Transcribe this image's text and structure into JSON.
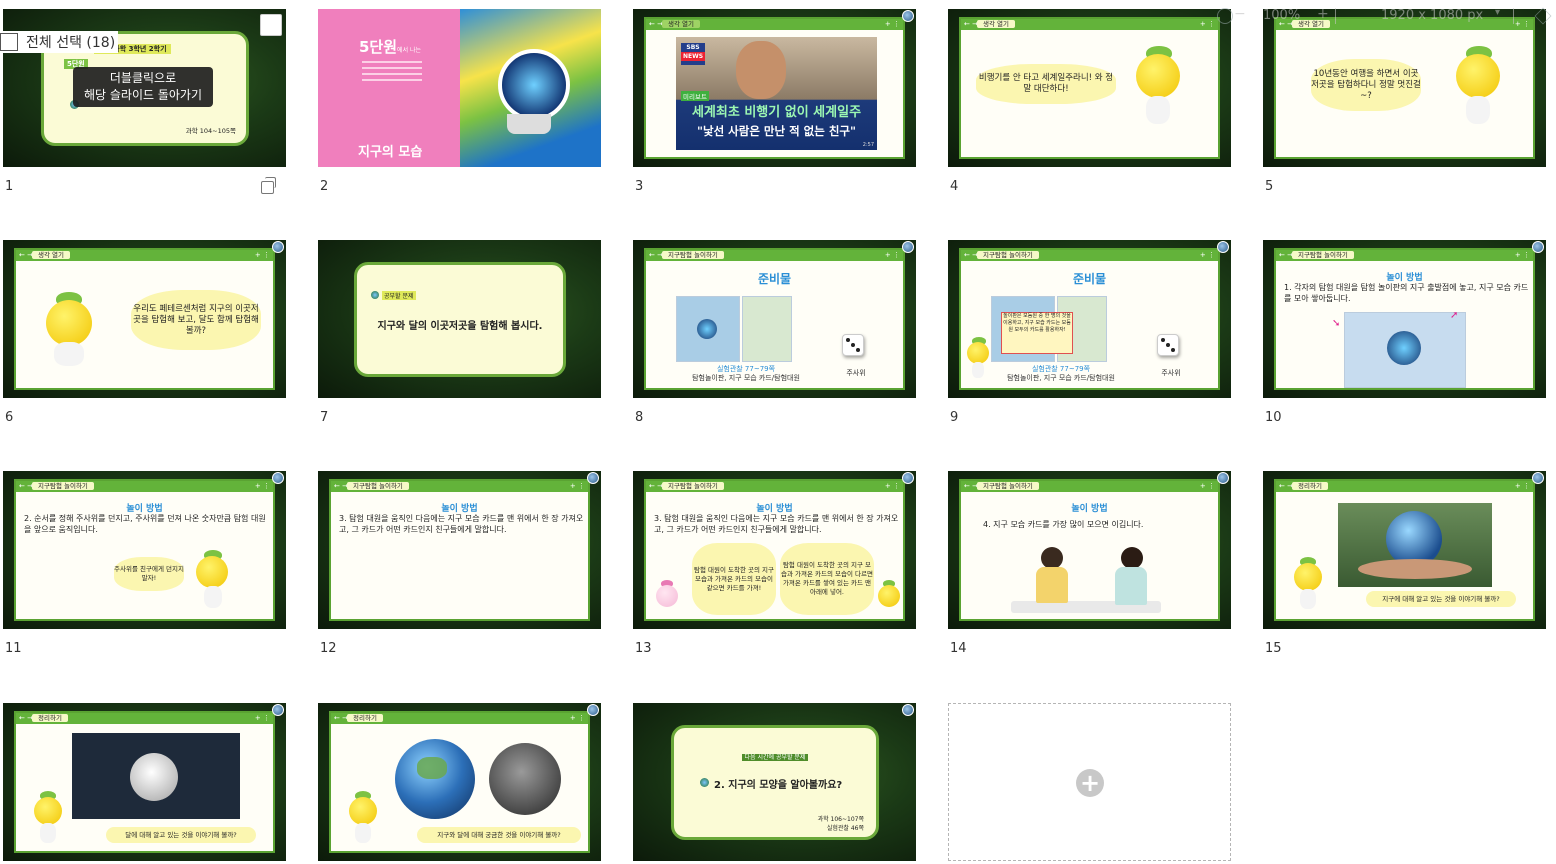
{
  "toolbar": {
    "zoom": "100%",
    "zoom_minus": "−",
    "size": "1920 x 1080 px",
    "select_all_label": "전체 선택 (18)"
  },
  "tooltip": {
    "line1": "더블클릭으로",
    "line2": "해당 슬라이드 돌아가기"
  },
  "slides": [
    {
      "num": "1",
      "subject": "(이) 과학 3학년 2학기",
      "pages": "과학 104~105쪽",
      "unit_badge": "5단원"
    },
    {
      "num": "2",
      "unit": "5단원",
      "unit_sub": "에서 나는",
      "title": "지구의 모습"
    },
    {
      "num": "3",
      "tab": "생각 열기",
      "news_logo_1": "SBS",
      "news_logo_2": "NEWS",
      "tag": "미리보트",
      "head1": "세계최초 비행기 없이 세계일주",
      "head2": "\"낯선 사람은 만난 적 없는 친구\"",
      "time": "2:57"
    },
    {
      "num": "4",
      "tab": "생각 열기",
      "bubble": "비행기를 안 타고 세계일주라니! 와 정말 대단하다!"
    },
    {
      "num": "5",
      "tab": "생각 열기",
      "bubble": "10년동안 여행을 하면서 이곳저곳을 탐험하다니 정말 멋진걸~?"
    },
    {
      "num": "6",
      "tab": "생각 열기",
      "bubble": "우리도 페테르센처럼 지구의 이곳저곳을 탐험해 보고, 달도 함께 탐험해 볼까?"
    },
    {
      "num": "7",
      "badge": "공부할 문제",
      "text": "지구와 달의 이곳저곳을 탐험해 봅시다."
    },
    {
      "num": "8",
      "tab": "지구탐험 놀이하기",
      "title": "준비물",
      "caption1": "실험관찰 77~79쪽",
      "caption2": "탐험놀이판, 지구 모습 카드/탐험대원",
      "dice": "주사위"
    },
    {
      "num": "9",
      "tab": "지구탐험 놀이하기",
      "title": "준비물",
      "note": "놀이판은 모둠원 중 한 명의 것을 이용하고, 지구 모습 카드는 모둠원 모두의 카드를 활용하자!",
      "caption1": "실험관찰 77~79쪽",
      "caption2": "탐험놀이판, 지구 모습 카드/탐험대원",
      "dice": "주사위"
    },
    {
      "num": "10",
      "tab": "지구탐험 놀이하기",
      "title": "놀이 방법",
      "text": "1. 각자의 탐험 대원을 탐험 놀이판의 지구 출발점에 놓고, 지구 모습 카드를 모아 쌓아둡니다."
    },
    {
      "num": "11",
      "tab": "지구탐험 놀이하기",
      "title": "놀이 방법",
      "text": "2. 순서를 정해 주사위를 던지고, 주사위를 던져 나온 숫자만큼 탐험 대원을 앞으로 움직입니다.",
      "bubble": "주사위를 친구에게 던지지 말자!"
    },
    {
      "num": "12",
      "tab": "지구탐험 놀이하기",
      "title": "놀이 방법",
      "text": "3. 탐험 대원을 움직인 다음에는 지구 모습 카드를 맨 위에서 한 장 가져오고, 그 카드가 어떤 카드인지 친구들에게 말합니다."
    },
    {
      "num": "13",
      "tab": "지구탐험 놀이하기",
      "title": "놀이 방법",
      "text": "3. 탐험 대원을 움직인 다음에는 지구 모습 카드를 맨 위에서 한 장 가져오고, 그 카드가 어떤 카드인지 친구들에게 말합니다.",
      "bubble1": "탐험 대원이 도착한 곳의 지구 모습과 가져온 카드의 모습이 같으면 카드를 가져!",
      "bubble2": "탐험 대원이 도착한 곳의 지구 모습과 가져온 카드의 모습이 다르면 가져온 카드를 쌓여 있는 카드 맨 아래에 넣어."
    },
    {
      "num": "14",
      "tab": "지구탐험 놀이하기",
      "title": "놀이 방법",
      "text": "4. 지구 모습 카드를 가장 많이 모으면 이깁니다."
    },
    {
      "num": "15",
      "tab": "정리하기",
      "bubble": "지구에 대해 알고 있는 것을 이야기해 볼까?"
    },
    {
      "num": "16",
      "tab": "정리하기",
      "bubble": "달에 대해 알고 있는 것을 이야기해 볼까?"
    },
    {
      "num": "17",
      "tab": "정리하기",
      "bubble": "지구와 달에 대해 궁금한 것을 이야기해 볼까?"
    },
    {
      "num": "18",
      "badge": "다음 시간에 공부할 문제",
      "text": "2. 지구의 모양을 알아볼까요?",
      "pages1": "과학 106~107쪽",
      "pages2": "실험관찰 46쪽"
    }
  ],
  "add_slide": {
    "icon": "plus-icon"
  }
}
